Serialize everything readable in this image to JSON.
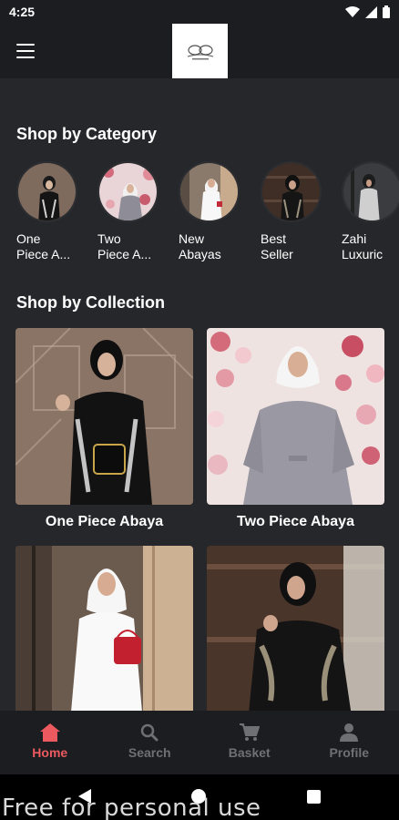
{
  "status_bar": {
    "time": "4:25",
    "icons": [
      "wifi-icon",
      "signal-icon",
      "battery-icon"
    ]
  },
  "app_bar": {
    "menu_icon": "hamburger-icon",
    "logo": "brand-logo"
  },
  "categories_section": {
    "title": "Shop by Category",
    "items": [
      {
        "label": "One\nPiece A...",
        "image": "one-piece-abaya-photo"
      },
      {
        "label": "Two\nPiece A...",
        "image": "two-piece-abaya-photo"
      },
      {
        "label": "New\nAbayas",
        "image": "new-abayas-photo"
      },
      {
        "label": "Best\nSeller",
        "image": "best-seller-photo"
      },
      {
        "label": "Zahi\nLuxuric",
        "image": "zahi-luxury-photo"
      }
    ]
  },
  "collections_section": {
    "title": "Shop by Collection",
    "items": [
      {
        "title": "One Piece Abaya"
      },
      {
        "title": "Two Piece Abaya"
      },
      {
        "title": ""
      },
      {
        "title": ""
      }
    ]
  },
  "bottom_nav": {
    "items": [
      {
        "label": "Home",
        "icon": "home-icon",
        "active": true
      },
      {
        "label": "Search",
        "icon": "search-icon",
        "active": false
      },
      {
        "label": "Basket",
        "icon": "cart-icon",
        "active": false
      },
      {
        "label": "Profile",
        "icon": "person-icon",
        "active": false
      }
    ]
  },
  "watermark": "Free for personal use",
  "colors": {
    "accent": "#ec5a5f",
    "background": "#26272b",
    "bar": "#1c1d20",
    "inactive": "#6f7073"
  }
}
